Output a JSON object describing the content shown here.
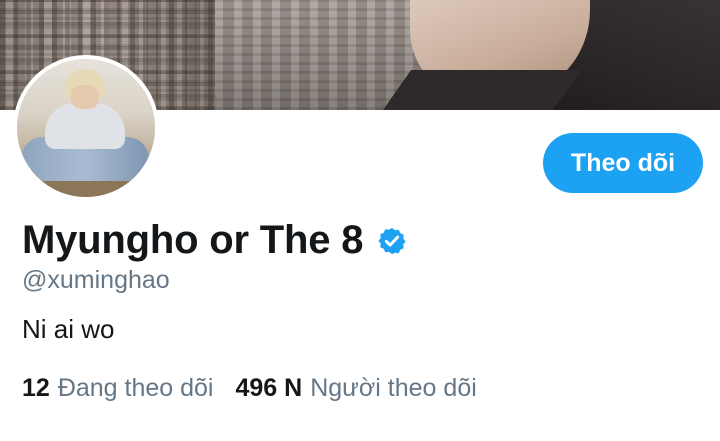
{
  "profile": {
    "display_name": "Myungho or The 8",
    "verified": true,
    "handle": "@xuminghao",
    "bio": "Ni ai wo",
    "follow_button_label": "Theo dõi",
    "following": {
      "count": "12",
      "label": "Đang theo dõi"
    },
    "followers": {
      "count": "496 N",
      "label": "Người theo dõi"
    }
  },
  "colors": {
    "accent": "#1da1f2",
    "text_primary": "#14171a",
    "text_secondary": "#657786"
  },
  "icons": {
    "verified": "verified-badge-icon"
  }
}
